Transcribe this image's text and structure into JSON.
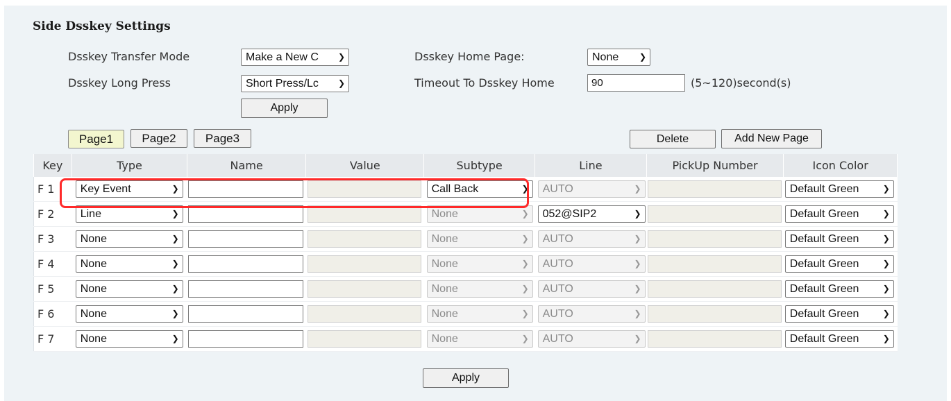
{
  "section_title": "Side Dsskey Settings",
  "transfer_mode": {
    "label": "Dsskey Transfer Mode",
    "value": "Make a New C"
  },
  "long_press": {
    "label": "Dsskey Long Press",
    "value": "Short Press/Lc"
  },
  "home_page": {
    "label": "Dsskey Home Page:",
    "value": "None"
  },
  "timeout": {
    "label": "Timeout To Dsskey Home",
    "value": "90",
    "unit": "(5~120)second(s)"
  },
  "apply_top": "Apply",
  "pages": [
    "Page1",
    "Page2",
    "Page3"
  ],
  "active_page": "Page1",
  "delete_button": "Delete",
  "add_page_button": "Add New Page",
  "columns": [
    "Key",
    "Type",
    "Name",
    "Value",
    "Subtype",
    "Line",
    "PickUp Number",
    "Icon Color"
  ],
  "rows": [
    {
      "key": "F 1",
      "type": "Key Event",
      "name": "",
      "value": "",
      "subtype": "Call Back",
      "line": "AUTO",
      "pickup": "",
      "icon_color": "Default Green"
    },
    {
      "key": "F 2",
      "type": "Line",
      "name": "",
      "value": "",
      "subtype": "None",
      "line": "052@SIP2",
      "pickup": "",
      "icon_color": "Default Green"
    },
    {
      "key": "F 3",
      "type": "None",
      "name": "",
      "value": "",
      "subtype": "None",
      "line": "AUTO",
      "pickup": "",
      "icon_color": "Default Green"
    },
    {
      "key": "F 4",
      "type": "None",
      "name": "",
      "value": "",
      "subtype": "None",
      "line": "AUTO",
      "pickup": "",
      "icon_color": "Default Green"
    },
    {
      "key": "F 5",
      "type": "None",
      "name": "",
      "value": "",
      "subtype": "None",
      "line": "AUTO",
      "pickup": "",
      "icon_color": "Default Green"
    },
    {
      "key": "F 6",
      "type": "None",
      "name": "",
      "value": "",
      "subtype": "None",
      "line": "AUTO",
      "pickup": "",
      "icon_color": "Default Green"
    },
    {
      "key": "F 7",
      "type": "None",
      "name": "",
      "value": "",
      "subtype": "None",
      "line": "AUTO",
      "pickup": "",
      "icon_color": "Default Green"
    }
  ],
  "enabled": {
    "subtype_rows": [
      0
    ],
    "line_rows": [
      1
    ]
  },
  "apply_bottom": "Apply",
  "highlight_color": "#ff2a2a",
  "icons": {
    "dropdown": "chevron-down-icon"
  }
}
